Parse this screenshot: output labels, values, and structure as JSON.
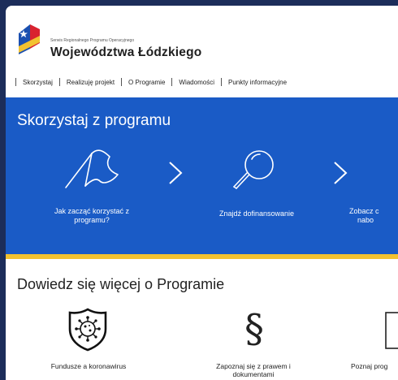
{
  "header": {
    "small_title": "Serwis Regionalnego Programu Operacyjnego",
    "title": "Województwa Łódzkiego"
  },
  "nav": {
    "items": [
      "Skorzystaj",
      "Realizuję projekt",
      "O Programie",
      "Wiadomości",
      "Punkty informacyjne"
    ]
  },
  "program": {
    "title": "Skorzystaj z programu",
    "steps": [
      {
        "label_line1": "Jak zacząć korzystać z",
        "label_line2": "programu?",
        "icon": "flag-icon"
      },
      {
        "label_line1": "Znajdź dofinansowanie",
        "label_line2": "",
        "icon": "magnifier-icon"
      },
      {
        "label_line1": "Zobacz c",
        "label_line2": "nabo",
        "icon": "calendar-icon"
      }
    ]
  },
  "learn": {
    "title": "Dowiedz się więcej o Programie",
    "items": [
      {
        "label_line1": "Fundusze a koronawirus",
        "label_line2": "",
        "icon": "virus-shield-icon"
      },
      {
        "label_line1": "Zapoznaj się z prawem i",
        "label_line2": "dokumentami",
        "icon": "paragraph-icon"
      },
      {
        "label_line1": "Poznaj prog",
        "label_line2": "",
        "icon": "document-icon"
      }
    ]
  },
  "colors": {
    "blue": "#1a5bc6",
    "band": "#f2c230",
    "outer": "#1c2d5a"
  }
}
